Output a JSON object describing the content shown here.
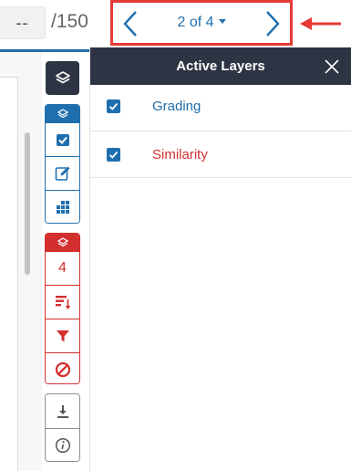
{
  "header": {
    "score_value": "--",
    "score_total": "/150",
    "page_indicator": "2 of 4"
  },
  "toolbar": {
    "similarity_count": "4"
  },
  "panel": {
    "title": "Active Layers",
    "layers": [
      {
        "label": "Grading",
        "checked": true,
        "color": "#1f6fae"
      },
      {
        "label": "Similarity",
        "checked": true,
        "color": "#d32f2f"
      }
    ]
  },
  "colors": {
    "accent_blue": "#1f6fae",
    "accent_red": "#d32f2f",
    "dark": "#2d3444",
    "highlight_red": "#e53935"
  },
  "icons": {
    "layers": "layers-icon",
    "checkmark": "check-icon",
    "edit": "edit-icon",
    "grid": "grid-icon",
    "sort": "sort-icon",
    "filter": "filter-icon",
    "exclude": "exclude-icon",
    "download": "download-icon",
    "info": "info-icon",
    "close": "close-icon"
  }
}
